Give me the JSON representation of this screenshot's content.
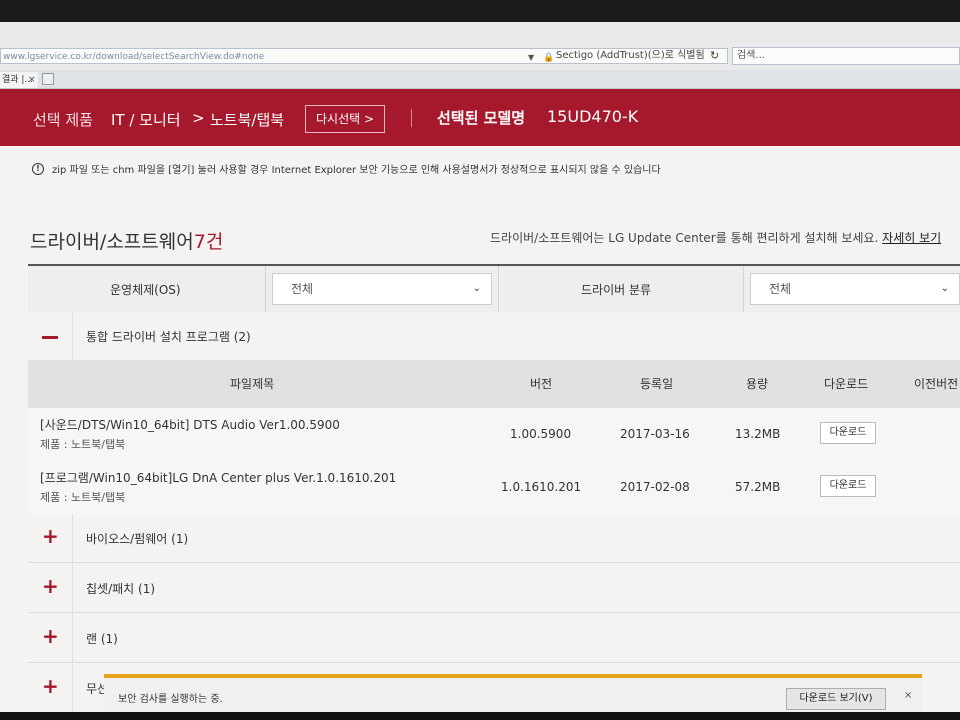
{
  "browser": {
    "url": "www.lgservice.co.kr/download/selectSearchView.do#none",
    "certificate": "Sectigo (AddTrust)(으)로 식별됨",
    "search_placeholder": "검색...",
    "tab_title": "결과 |...",
    "tab_close": "×"
  },
  "header": {
    "selected_product_label": "선택 제품",
    "category_1": "IT / 모니터",
    "separator": ">",
    "category_2": "노트북/탭북",
    "reselect_button": "다시선택 >",
    "selected_model_label": "선택된 모델명",
    "model": "15UD470-K"
  },
  "notice": {
    "icon": "!",
    "text": "zip 파일 또는 chm 파일을 [열기] 눌러 사용할 경우 Internet Explorer 보안 기능으로 인해 사용설명서가 정상적으로 표시되지 않을 수 있습니다"
  },
  "section": {
    "title": "드라이버/소프트웨어",
    "count": "7건",
    "info": "드라이버/소프트웨어는 LG Update Center를 통해 편리하게 설치해 보세요.",
    "info_link": "자세히 보기"
  },
  "filters": {
    "os_label": "운영체제(OS)",
    "os_value": "전체",
    "category_label": "드라이버 분류",
    "category_value": "전체"
  },
  "groups": [
    {
      "title": "통합 드라이버 설치 프로그램 (2)",
      "sign": "−",
      "expanded": true
    },
    {
      "title": "바이오스/펌웨어 (1)",
      "sign": "+"
    },
    {
      "title": "칩셋/패치 (1)",
      "sign": "+"
    },
    {
      "title": "랜 (1)",
      "sign": "+"
    },
    {
      "title": "무선",
      "sign": "+"
    }
  ],
  "table": {
    "headers": [
      "파일제목",
      "버전",
      "등록일",
      "용량",
      "다운로드",
      "이전버전"
    ],
    "rows": [
      {
        "title": "[사운드/DTS/Win10_64bit] DTS Audio Ver1.00.5900",
        "product": "제품 : 노트북/탭북",
        "version": "1.00.5900",
        "date": "2017-03-16",
        "size": "13.2MB",
        "download": "다운로드"
      },
      {
        "title": "[프로그램/Win10_64bit]LG DnA Center plus Ver.1.0.1610.201",
        "product": "제품 : 노트북/탭북",
        "version": "1.0.1610.201",
        "date": "2017-02-08",
        "size": "57.2MB",
        "download": "다운로드"
      }
    ]
  },
  "download_bar": {
    "message": "보안 검사를 실행하는 중.",
    "view_button": "다운로드 보기(V)",
    "close": "×"
  },
  "colors": {
    "brand_red": "#a6182c",
    "notify_bar": "#e3a21a"
  }
}
